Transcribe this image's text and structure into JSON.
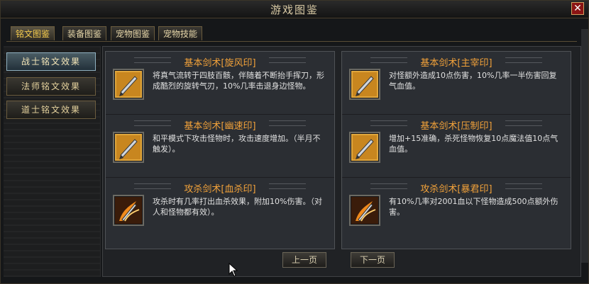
{
  "window": {
    "title": "游戏图鉴",
    "close_label": "✕"
  },
  "tabs": [
    {
      "label": "铭文图鉴",
      "active": true
    },
    {
      "label": "装备图鉴",
      "active": false
    },
    {
      "label": "宠物图鉴",
      "active": false
    },
    {
      "label": "宠物技能",
      "active": false
    }
  ],
  "sidebar": {
    "items": [
      {
        "label": "战士铭文效果",
        "active": true
      },
      {
        "label": "法师铭文效果",
        "active": false
      },
      {
        "label": "道士铭文效果",
        "active": false
      }
    ]
  },
  "entries_left": [
    {
      "title": "基本剑术[旋风印]",
      "desc": "将真气流转于四肢百骸，伴随着不断抬手挥刀，形成酷烈的旋转气刃，10%几率击退身边怪物。",
      "icon": "sword-icon"
    },
    {
      "title": "基本剑术[幽速印]",
      "desc": "和平模式下攻击怪物时，攻击速度增加。（半月不触发）。",
      "icon": "sword-icon"
    },
    {
      "title": "攻杀剑术[血杀印]",
      "desc": "攻杀时有几率打出血杀效果，附加10%伤害。（对人和怪物都有效）。",
      "icon": "flaming-sword-icon"
    }
  ],
  "entries_right": [
    {
      "title": "基本剑术[主宰印]",
      "desc": "对怪额外造成10点伤害，10%几率一半伤害回复气血值。",
      "icon": "sword-icon"
    },
    {
      "title": "基本剑术[压制印]",
      "desc": "增加+15准确，杀死怪物恢复10点魔法值10点气血值。",
      "icon": "sword-icon"
    },
    {
      "title": "攻杀剑术[暴君印]",
      "desc": "有10%几率对2001血以下怪物造成500点额外伤害。",
      "icon": "flaming-sword-icon"
    }
  ],
  "pager": {
    "prev_label": "上一页",
    "next_label": "下一页"
  },
  "colors": {
    "title_orange": "#f2a23a",
    "tab_gold": "#f2c94c",
    "text": "#e1e1e1"
  }
}
